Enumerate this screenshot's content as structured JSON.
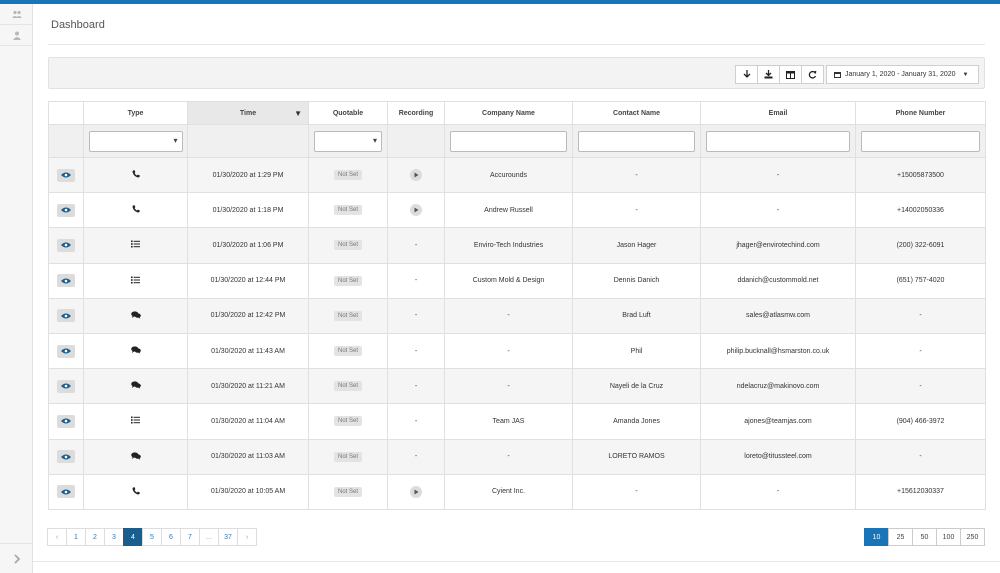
{
  "page": {
    "title": "Dashboard"
  },
  "toolbar": {
    "buttons": [
      "arrow-down-icon",
      "download-icon",
      "columns-icon",
      "refresh-icon"
    ],
    "date_range": "January 1, 2020 - January 31, 2020"
  },
  "table": {
    "columns": [
      "",
      "Type",
      "Time",
      "Quotable",
      "Recording",
      "Company Name",
      "Contact Name",
      "Email",
      "Phone Number"
    ],
    "sorted_column": "Time",
    "rows": [
      {
        "type_icon": "phone-icon",
        "time": "01/30/2020 at 1:29 PM",
        "quotable": "Not Set",
        "recording": "play",
        "company": "Accurounds",
        "contact": "-",
        "email": "-",
        "phone": "+15005873500"
      },
      {
        "type_icon": "phone-icon",
        "time": "01/30/2020 at 1:18 PM",
        "quotable": "Not Set",
        "recording": "play",
        "company": "Andrew Russell",
        "contact": "-",
        "email": "-",
        "phone": "+14002050336"
      },
      {
        "type_icon": "form-icon",
        "time": "01/30/2020 at 1:06 PM",
        "quotable": "Not Set",
        "recording": "-",
        "company": "Enviro-Tech Industries",
        "contact": "Jason Hager",
        "email": "jhager@envirotechind.com",
        "phone": "(200) 322-6091"
      },
      {
        "type_icon": "form-icon",
        "time": "01/30/2020 at 12:44 PM",
        "quotable": "Not Set",
        "recording": "-",
        "company": "Custom Mold & Design",
        "contact": "Dennis Danich",
        "email": "ddanich@custommold.net",
        "phone": "(651) 757-4020"
      },
      {
        "type_icon": "chat-icon",
        "time": "01/30/2020 at 12:42 PM",
        "quotable": "Not Set",
        "recording": "-",
        "company": "-",
        "contact": "Brad Luft",
        "email": "sales@atlasmw.com",
        "phone": "-"
      },
      {
        "type_icon": "chat-icon",
        "time": "01/30/2020 at 11:43 AM",
        "quotable": "Not Set",
        "recording": "-",
        "company": "-",
        "contact": "Phil",
        "email": "philip.bucknall@hsmarston.co.uk",
        "phone": "-"
      },
      {
        "type_icon": "chat-icon",
        "time": "01/30/2020 at 11:21 AM",
        "quotable": "Not Set",
        "recording": "-",
        "company": "-",
        "contact": "Nayeli de la Cruz",
        "email": "ndelacruz@makinovo.com",
        "phone": "-"
      },
      {
        "type_icon": "form-icon",
        "time": "01/30/2020 at 11:04 AM",
        "quotable": "Not Set",
        "recording": "-",
        "company": "Team JAS",
        "contact": "Amanda Jones",
        "email": "ajones@teamjas.com",
        "phone": "(904) 466-3972"
      },
      {
        "type_icon": "chat-icon",
        "time": "01/30/2020 at 11:03 AM",
        "quotable": "Not Set",
        "recording": "-",
        "company": "-",
        "contact": "LORETO RAMOS",
        "email": "loreto@titussteel.com",
        "phone": "-"
      },
      {
        "type_icon": "phone-icon",
        "time": "01/30/2020 at 10:05 AM",
        "quotable": "Not Set",
        "recording": "play",
        "company": "Cyient Inc.",
        "contact": "-",
        "email": "-",
        "phone": "+15612030337"
      }
    ]
  },
  "pagination": {
    "pages": [
      "‹",
      "1",
      "2",
      "3",
      "4",
      "5",
      "6",
      "7",
      "...",
      "37",
      "›"
    ],
    "active": "4"
  },
  "page_sizes": {
    "options": [
      "10",
      "25",
      "50",
      "100",
      "250"
    ],
    "active": "10"
  }
}
